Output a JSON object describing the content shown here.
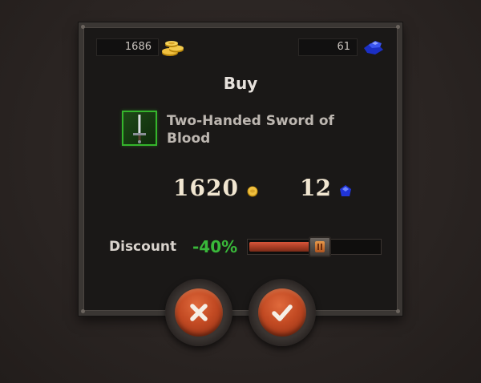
{
  "resources": {
    "gold": "1686",
    "gems": "61"
  },
  "dialog": {
    "title": "Buy",
    "item_name": "Two-Handed Sword of Blood",
    "price_gold": "1620",
    "price_gems": "12",
    "discount_label": "Discount",
    "discount_value": "-40%",
    "discount_fraction": 0.4
  },
  "icons": {
    "gold": "gold-coins-icon",
    "gems": "blue-gems-icon",
    "item": "two-handed-sword-icon",
    "cancel": "close-x-icon",
    "confirm": "checkmark-icon"
  },
  "colors": {
    "item_rarity_border": "#35b52c",
    "discount_text": "#39b83a",
    "button_face": "#c24a23",
    "slider_fill": "#d8553a"
  }
}
